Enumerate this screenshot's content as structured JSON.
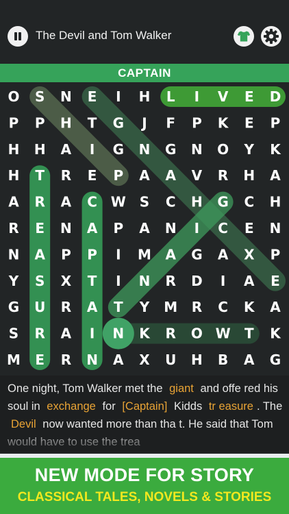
{
  "header": {
    "title": "The Devil and Tom Walker"
  },
  "target_word": "CAPTAIN",
  "colors": {
    "background": "#222526",
    "accent_green": "#36a35a",
    "found_word": "#3e9a35",
    "banner_green": "#3bab3e",
    "banner_yellow": "#f3e81f",
    "highlight_orange": "#e8a335"
  },
  "grid": {
    "rows": [
      "OSNEIHLIVED",
      "PPHTGJFPKEP",
      "HHAIGNGNOYK",
      "HTREPAAVRHA",
      "ARACWSCHGCH",
      "RENAPANICEN",
      "NAPPIMAGAXP",
      "YSXTINRDIAE",
      "GURATYMRCKA",
      "SRAINKROWTK",
      "MERNAXUHBAG"
    ]
  },
  "story": {
    "p1": "One night, Tom Walker met the",
    "w1": "giant",
    "p2": "and offe red his soul in",
    "w2": "exchange",
    "p3": "for",
    "w3": "[Captain]",
    "p4": "Kidds",
    "w4": "tr easure",
    "p5": ". The",
    "w5": "Devil",
    "p6": "now wanted more than tha t. He said that Tom would have to use the trea"
  },
  "banner": {
    "title": "NEW MODE FOR STORY",
    "subtitle": "CLASSICAL TALES, NOVELS & STORIES"
  }
}
